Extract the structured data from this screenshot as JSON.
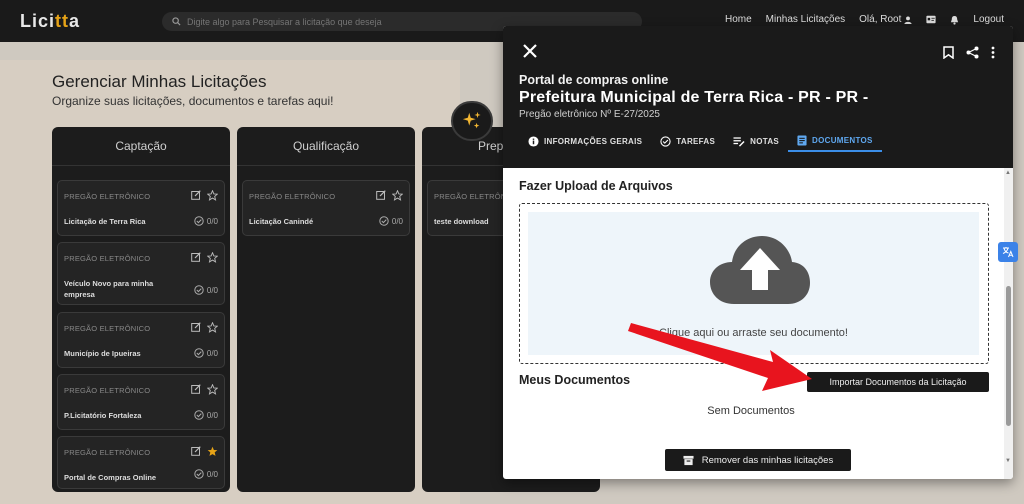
{
  "app": {
    "logo_main": "Lici",
    "logo_accent": "tt",
    "logo_end": "a"
  },
  "search": {
    "placeholder": "Digite algo para Pesquisar a licitação que deseja"
  },
  "nav": {
    "home": "Home",
    "my_bids": "Minhas Licitações",
    "greeting": "Olá, Root",
    "logout": "Logout"
  },
  "page": {
    "title": "Gerenciar Minhas Licitações",
    "subtitle": "Organize suas licitações, documentos e tarefas aqui!"
  },
  "columns": [
    {
      "name": "Captação",
      "cards": [
        {
          "kind": "PREGÃO ELETRÔNICO",
          "title": "Licitação de Terra Rica",
          "count": "0/0",
          "starred": false
        },
        {
          "kind": "PREGÃO ELETRÔNICO",
          "title": "Veículo Novo para minha empresa",
          "count": "0/0",
          "starred": false
        },
        {
          "kind": "PREGÃO ELETRÔNICO",
          "title": "Município de Ipueiras",
          "count": "0/0",
          "starred": false
        },
        {
          "kind": "PREGÃO ELETRÔNICO",
          "title": "P.Licitatório Fortaleza",
          "count": "0/0",
          "starred": false
        },
        {
          "kind": "PREGÃO ELETRÔNICO",
          "title": "Portal de Compras Online",
          "count": "0/0",
          "starred": true
        }
      ]
    },
    {
      "name": "Qualificação",
      "cards": [
        {
          "kind": "PREGÃO ELETRÔNICO",
          "title": "Licitação Canindé",
          "count": "0/0",
          "starred": false
        }
      ]
    },
    {
      "name": "Prep",
      "cards": [
        {
          "kind": "PREGÃO ELETRÔNICO",
          "title": "teste download",
          "count": "",
          "starred": false
        }
      ]
    }
  ],
  "modal": {
    "portal": "Portal de compras online",
    "entity": "Prefeitura Municipal de Terra Rica - PR - PR -",
    "process": "Pregão eletrônico Nº E-27/2025",
    "tabs": [
      {
        "label": "INFORMAÇÕES GERAIS",
        "icon": "info-icon",
        "active": false
      },
      {
        "label": "TAREFAS",
        "icon": "check-circle-icon",
        "active": false
      },
      {
        "label": "NOTAS",
        "icon": "notes-icon",
        "active": false
      },
      {
        "label": "DOCUMENTOS",
        "icon": "document-icon",
        "active": true
      }
    ],
    "upload_title": "Fazer Upload de Arquivos",
    "drop_text": "Clique aqui ou arraste seu documento!",
    "docs_title": "Meus Documentos",
    "import_label": "Importar Documentos da Licitação",
    "no_docs": "Sem Documentos",
    "remove_label": "Remover das minhas licitações"
  },
  "colors": {
    "accent_blue": "#3b8ee8",
    "logo_accent": "#e6a317",
    "star": "#e6a317",
    "arrow": "#e8141e"
  }
}
